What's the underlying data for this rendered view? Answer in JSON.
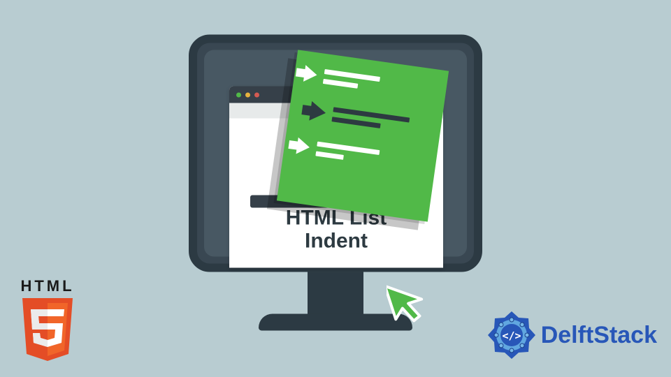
{
  "illustration": {
    "title_line1": "HTML List",
    "title_line2": "Indent"
  },
  "logos": {
    "html5_label": "HTML",
    "delftstack_label": "DelftStack"
  },
  "colors": {
    "background": "#b8ccd1",
    "monitor_dark": "#2c3a43",
    "monitor_mid": "#394752",
    "green": "#51b948",
    "accent_blue": "#2857b8",
    "html5_orange": "#e44d26"
  }
}
